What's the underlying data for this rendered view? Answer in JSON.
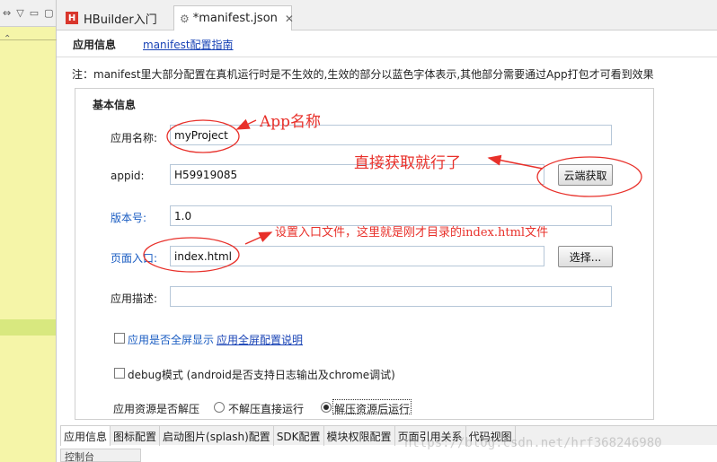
{
  "tabs": [
    {
      "label": "HBuilder入门",
      "icon": "hbuilder-icon",
      "close": ""
    },
    {
      "label": "*manifest.json",
      "icon": "gear-file-icon",
      "close": "✕"
    }
  ],
  "header": {
    "title": "应用信息",
    "guide_link": "manifest配置指南"
  },
  "note": "注：manifest里大部分配置在真机运行时是不生效的,生效的部分以蓝色字体表示,其他部分需要通过App打包才可看到效果",
  "section": {
    "title": "基本信息"
  },
  "fields": {
    "app_name": {
      "label": "应用名称:",
      "value": "myProject"
    },
    "appid": {
      "label": "appid:",
      "value": "H59919085",
      "button": "云端获取"
    },
    "version": {
      "label": "版本号:",
      "value": "1.0"
    },
    "entry": {
      "label": "页面入口:",
      "value": "index.html",
      "button": "选择..."
    },
    "description": {
      "label": "应用描述:",
      "value": ""
    }
  },
  "options": {
    "fullscreen": {
      "label": "应用是否全屏显示",
      "link": "应用全屏配置说明",
      "checked": false
    },
    "debug": {
      "label": "debug模式 (android是否支持日志输出及chrome调试)",
      "checked": false
    },
    "decompress": {
      "label": "应用资源是否解压",
      "choices": [
        "不解压直接运行",
        "解压资源后运行"
      ],
      "selected": "解压资源后运行"
    }
  },
  "annotations": {
    "app_name": "App名称",
    "appid": "直接获取就行了",
    "entry": "设置入口文件，这里就是刚才目录的index.html文件",
    "color": "#e8302a"
  },
  "bottom_tabs": [
    "应用信息",
    "图标配置",
    "启动图片(splash)配置",
    "SDK配置",
    "模块权限配置",
    "页面引用关系",
    "代码视图"
  ],
  "watermark": "https://blog.csdn.net/hrf368246980",
  "console_tab": "控制台"
}
